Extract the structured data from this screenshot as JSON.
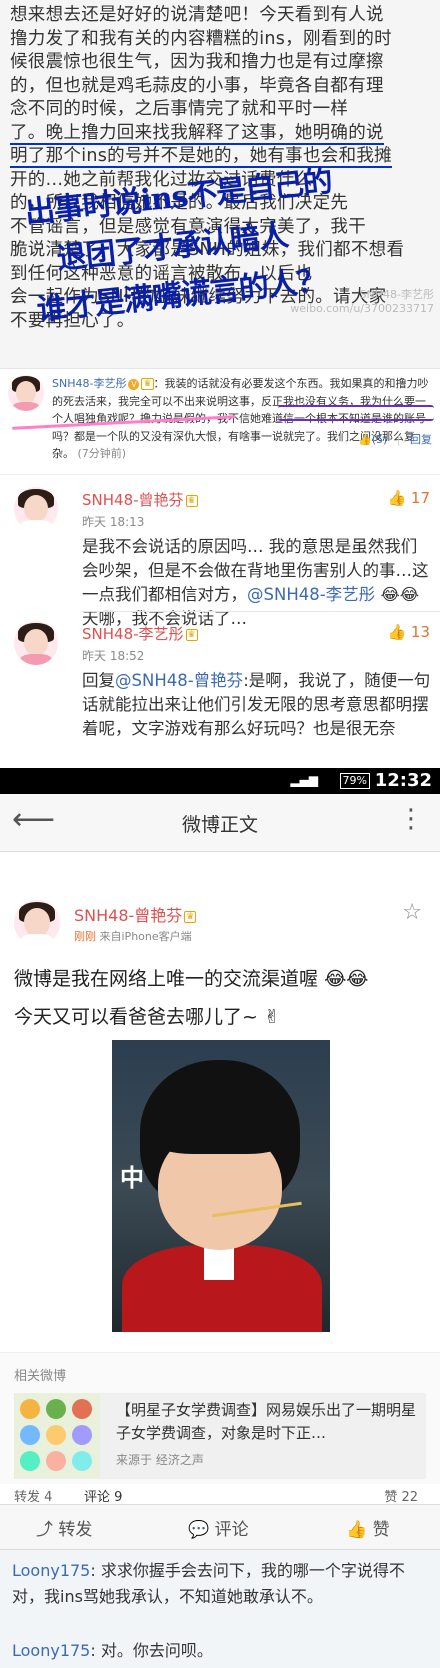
{
  "post_text": {
    "lines": [
      "想来想去还是好好的说清楚吧！今天看到有人说",
      "撸力发了和我有关的内容糟糕的ins，刚看到的时",
      "候很震惊也很生气，因为我和撸力也是有过摩擦",
      "的，但也就是鸡毛蒜皮的小事，毕竟各自都有理",
      "念不同的时候，之后事情完了就和平时一样",
      "了。晚上撸力回来找我解释了这事，她明确的说",
      "明了那个ins的号并不是她的，她有事也会和我摊",
      "开的...她之前帮我化过妆交过话费什么",
      "的，所以我相信她不是的。最后我们决定先",
      "不管谣言，但是感觉有意演得太完美了，我干",
      "脆说清楚了，大家都是SNH的姐妹，我们都不想看",
      "到任何这种恶意的谣言被散布，以后也",
      "会一起作为SNH的姐妹继续努力下去的。请大家",
      "不要再担心了。"
    ],
    "watermark": "SNH48-李艺彤",
    "watermark_url": "weibo.com/u/3700233717",
    "overlay_1": "出事时说ins不是自己的",
    "overlay_2": "退团了才承认暗人",
    "overlay_3": "谁才是满嘴谎言的人？"
  },
  "comment_lyt": {
    "name": "SNH48-李艺彤",
    "text": "我装的话就没有必要发这个东西。我如果真的和撸力吵的死去活来，我完全可以不出来说明这事，反正我也没有义务，我为什么要一个人唱独角戏呢？撸力说是假的，我不信她难道信一个根本不知道是谁的账号吗？都是一个队的又没有深仇大恨，有啥事一说就完了。我们之间没那么复杂。",
    "time": "(7分钟前)",
    "likes": "(5)",
    "reply": "回复"
  },
  "replies": [
    {
      "name": "SNH48-曾艳芬",
      "time": "昨天 18:13",
      "likes": "17",
      "text_a": "是我不会说话的原因吗… 我的意思是虽然我们会吵架，但是不会做在背地里伤害别人的事…这一点我们都相信对方，",
      "at": "@SNH48-李艺彤",
      "emoji": "😂😂",
      "text_b": "天哪，我不会说话了…"
    },
    {
      "name": "SNH48-李艺彤",
      "time": "昨天 18:52",
      "likes": "13",
      "prefix": "回复",
      "at": "@SNH48-曾艳芬",
      "text": ":是啊，我说了，随便一句话就能拉出来让他们引发无限的思考意思都明摆着呢，文字游戏有那么好玩吗？也是很无奈"
    }
  ],
  "statusbar": {
    "battery": "79%",
    "time": "12:32"
  },
  "topbar": {
    "title": "微博正文"
  },
  "post": {
    "name": "SNH48-曾艳芬",
    "meta_time": "刚刚",
    "meta_source": "来自iPhone客户端",
    "line1": "微博是我在网络上唯一的交流渠道喔",
    "line1_emoji": "😂😂",
    "line2": "今天又可以看爸爸去哪儿了~",
    "line2_emoji": "✌",
    "photo_text": "中"
  },
  "related": {
    "header": "相关微博",
    "title": "【明星子女学费调查】网易娱乐出了一期明星子女学费调查，对象是时下正…",
    "source": "来源于 经济之声"
  },
  "stats": {
    "reposts": "转发 4",
    "comments": "评论 9",
    "likes": "赞 22"
  },
  "actions": {
    "repost": "转发",
    "comment": "评论",
    "like": "赞"
  },
  "bottom_comments": [
    {
      "user": "Loony175",
      "text": ": 求求你握手会去问下，我的哪一个字说得不对，我ins骂她我承认，不知道她敢承认不。"
    },
    {
      "user": "Loony175",
      "text": ": 对。你去问呗。"
    }
  ]
}
